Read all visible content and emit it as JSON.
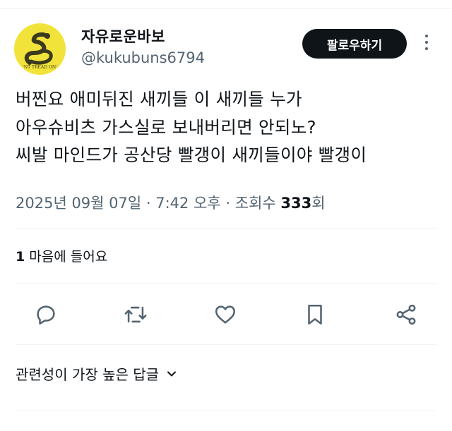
{
  "user": {
    "display_name": "자유로운바보",
    "handle": "@kukubuns6794",
    "avatar_text": "'NT TREAD ON'",
    "avatar_color": "#f2e33b"
  },
  "follow_button": {
    "label": "팔로우하기"
  },
  "more_menu": {
    "icon": "more-vertical-icon"
  },
  "tweet": {
    "lines": [
      "버찐요 애미뒤진 새끼들 이 새끼들 누가",
      "아우슈비츠 가스실로 보내버리면 안되노?",
      "씨발 마인드가 공산당 빨갱이 새끼들이야 빨갱이"
    ]
  },
  "meta": {
    "date": "2025년 09월 07일",
    "sep1": " · ",
    "time": "7:42 오후",
    "sep2": " · ",
    "views_label": "조회수 ",
    "views_count": "333",
    "views_suffix": "회"
  },
  "likes": {
    "count": "1",
    "label": " 마음에 들어요"
  },
  "actions": [
    "reply-icon",
    "retweet-icon",
    "like-icon",
    "bookmark-icon",
    "share-icon"
  ],
  "replies_sort": {
    "label": "관련성이 가장 높은 답글"
  },
  "colors": {
    "text": "#0f1419",
    "secondary": "#536471",
    "divider": "#eff3f4",
    "button": "#0f1419"
  }
}
